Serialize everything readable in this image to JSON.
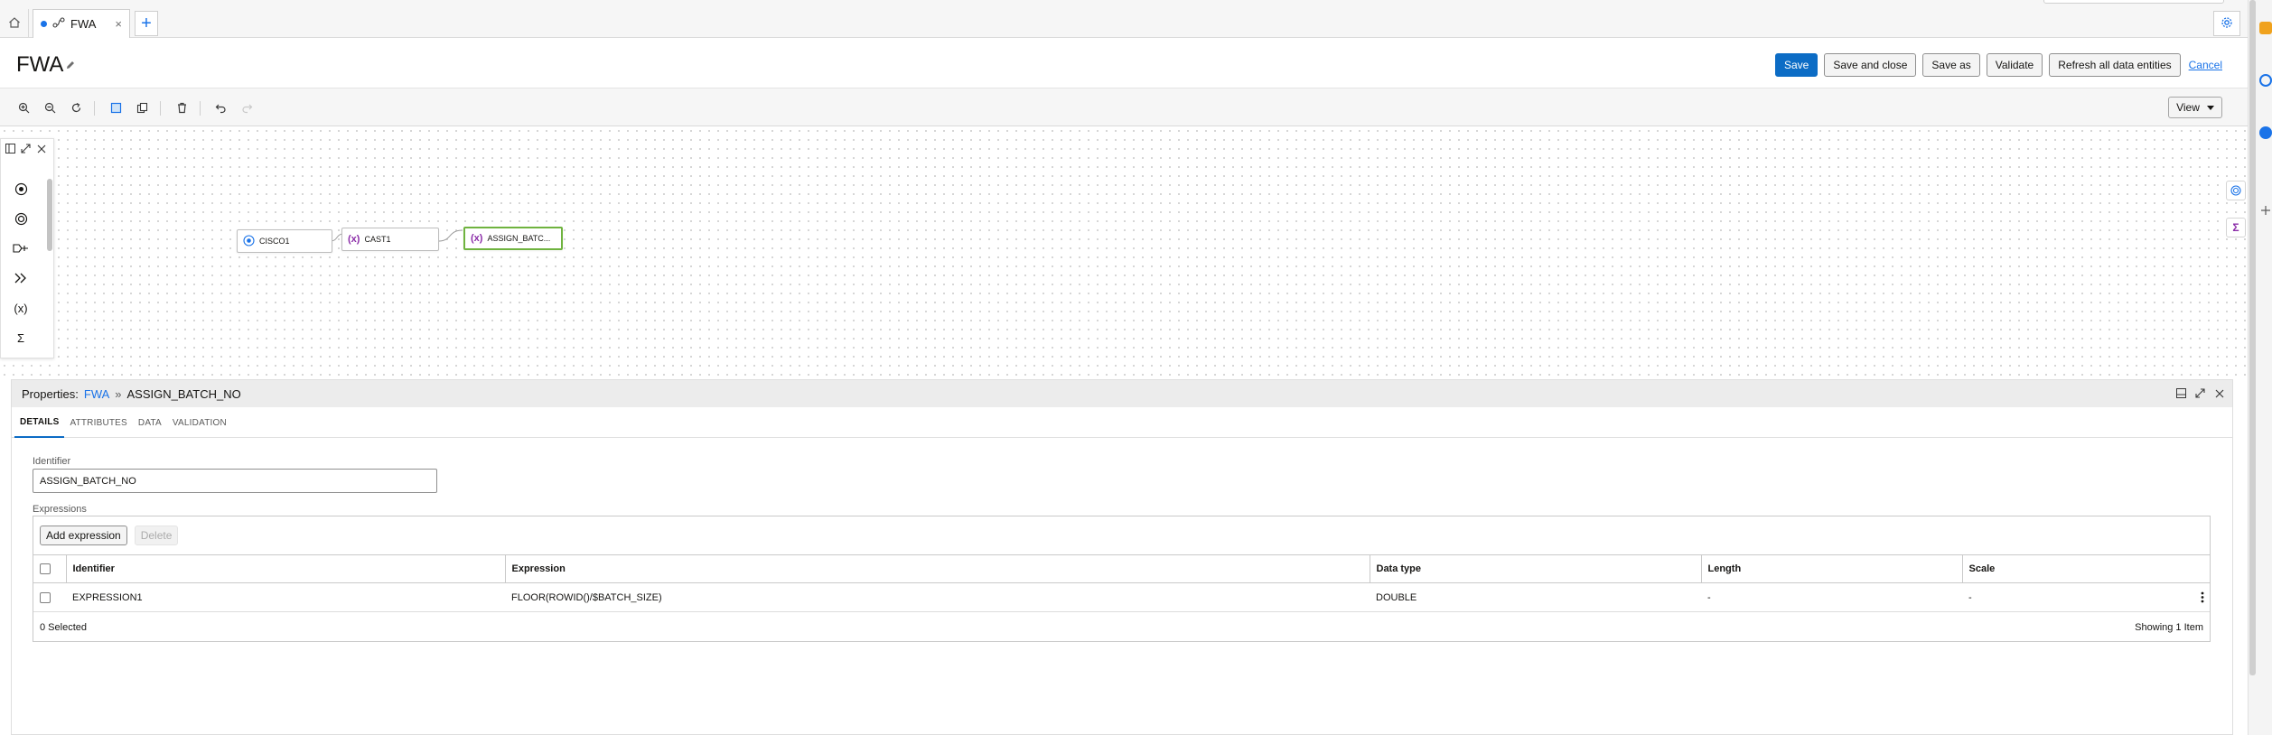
{
  "tabs": {
    "home_icon": "home-icon",
    "active_tab_label": "FWA",
    "active_tab_icon": "data-flow-icon",
    "close_glyph": "×",
    "add_glyph": "+"
  },
  "header": {
    "title": "FWA",
    "actions": {
      "save": "Save",
      "save_and_close": "Save and close",
      "save_as": "Save as",
      "validate": "Validate",
      "refresh": "Refresh all data entities",
      "cancel": "Cancel"
    }
  },
  "toolbar": {
    "view_label": "View"
  },
  "palette": {
    "items": [
      "source-operator-icon",
      "target-operator-icon",
      "filter-operator-icon",
      "join-operator-icon",
      "expression-operator-icon",
      "aggregate-operator-icon"
    ],
    "expression_glyph": "(x)",
    "aggregate_glyph": "Σ"
  },
  "canvas": {
    "nodes": [
      {
        "label": "CISCO1",
        "type": "source"
      },
      {
        "label": "CAST1",
        "type": "expression"
      },
      {
        "label": "ASSIGN_BATC...",
        "type": "expression",
        "selected": true
      }
    ],
    "expression_glyph": "(x)"
  },
  "properties": {
    "heading_prefix": "Properties:",
    "breadcrumb_link": "FWA",
    "breadcrumb_sep": "»",
    "breadcrumb_current": "ASSIGN_BATCH_NO",
    "tabs": [
      "DETAILS",
      "ATTRIBUTES",
      "DATA",
      "VALIDATION"
    ],
    "identifier_label": "Identifier",
    "identifier_value": "ASSIGN_BATCH_NO",
    "expressions_label": "Expressions",
    "add_expression": "Add expression",
    "delete": "Delete",
    "columns": [
      "Identifier",
      "Expression",
      "Data type",
      "Length",
      "Scale"
    ],
    "rows": [
      {
        "identifier": "EXPRESSION1",
        "expression": "FLOOR(ROWID()/$BATCH_SIZE)",
        "data_type": "DOUBLE",
        "length": "-",
        "scale": "-"
      }
    ],
    "selected_count": "0 Selected",
    "showing": "Showing 1 Item"
  },
  "colors": {
    "primary": "#0c6cc5",
    "link": "#1a73e8",
    "expression": "#8b2da8",
    "selected_node": "#6fb33f"
  }
}
